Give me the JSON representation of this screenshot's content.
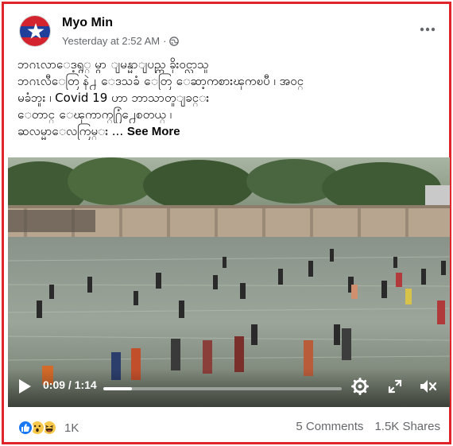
{
  "post": {
    "author": "Myo Min",
    "timestamp": "Yesterday at 2:52 AM",
    "separator": "·",
    "privacy_icon": "globe-icon",
    "more_icon": "more-horizontal-icon",
    "text_lines": [
      "ဘဂၤလာေဒ့ရွ္ မွာ ျမန္မာျပည္က ခိုး၀င္လာသူ",
      "ဘဂၤလီေတြ နဲ႕ ေဒသခံ ေတြ ေဆာ့ကစားၾကၿပီ ၊ အဝင္",
      "မခံဘူး ၊    Covid 19 ဟာ     ဘာသာတူျခင္း",
      "ေတာင္ ေၾကာက္႐ြံ႕ေစတယ္ ၊"
    ],
    "text_last": "ဆလမ္မာေလကြမ္း ...",
    "see_more": "See More"
  },
  "video": {
    "current_time": "0:09",
    "duration": "1:14",
    "time_display": "0:09 / 1:14",
    "progress_fraction": 0.12,
    "play_icon": "play-icon",
    "settings_icon": "gear-icon",
    "fullscreen_icon": "fullscreen-icon",
    "volume_icon": "volume-muted-icon"
  },
  "footer": {
    "reaction_icons": [
      "like-icon",
      "wow-icon",
      "haha-icon"
    ],
    "reaction_count": "1K",
    "comments": "5 Comments",
    "shares": "1.5K Shares"
  },
  "colors": {
    "border": "#e0242a",
    "like_blue": "#1877f2",
    "wow_yellow": "#f7c84a",
    "secondary_text": "#65676b"
  }
}
